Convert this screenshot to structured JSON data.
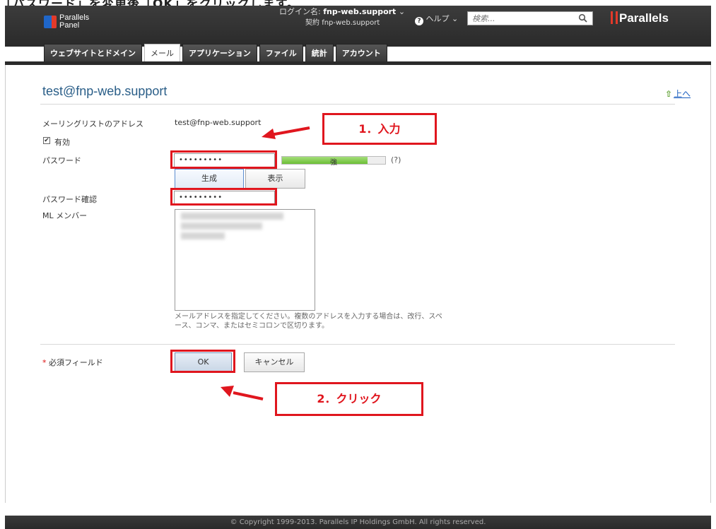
{
  "caption": "「パスワード」を変更後「OK」をクリックします。",
  "header": {
    "logo_line1": "Parallels",
    "logo_line2": "Panel",
    "login_label": "ログイン名:",
    "login_value": "fnp-web.support",
    "contract_label": "契約",
    "contract_value": "fnp-web.support",
    "help_label": "ヘルプ",
    "search_placeholder": "検索...",
    "brand": "Parallels"
  },
  "tabs": [
    {
      "label": "ウェブサイトとドメイン"
    },
    {
      "label": "メール"
    },
    {
      "label": "アプリケーション"
    },
    {
      "label": "ファイル"
    },
    {
      "label": "統計"
    },
    {
      "label": "アカウント"
    }
  ],
  "page": {
    "title": "test@fnp-web.support",
    "up_link": "上へ"
  },
  "form": {
    "address_label": "メーリングリストのアドレス",
    "address_value": "test@fnp-web.support",
    "enabled_label": "有効",
    "enabled_checked": true,
    "password_label": "パスワード",
    "password_value": "•••••••••",
    "strength_label": "強",
    "strength_fraction": 0.83,
    "strength_help": "(?)",
    "generate_label": "生成",
    "show_label": "表示",
    "confirm_label": "パスワード確認",
    "confirm_value": "•••••••••",
    "members_label": "ML メンバー",
    "hint": "メールアドレスを指定してください。複数のアドレスを入力する場合は、改行、スペース、コンマ、またはセミコロンで区切ります。",
    "required_mark": "*",
    "required_label": "必須フィールド",
    "ok_label": "OK",
    "cancel_label": "キャンセル"
  },
  "annotations": {
    "step1": "1．入力",
    "step2": "2．クリック",
    "color": "#e0161e"
  },
  "footer": "© Copyright 1999-2013. Parallels IP Holdings GmbH. All rights reserved."
}
